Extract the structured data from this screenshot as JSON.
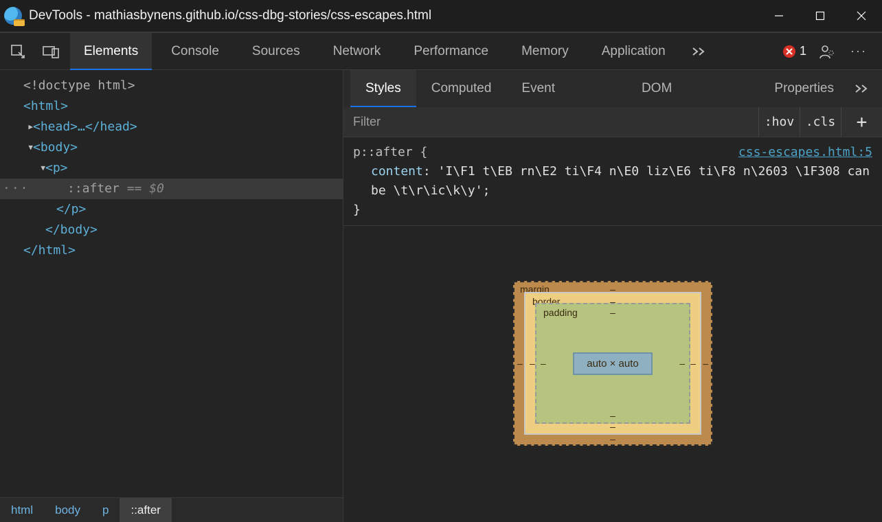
{
  "window": {
    "title": "DevTools - mathiasbynens.github.io/css-dbg-stories/css-escapes.html"
  },
  "mainTabs": {
    "elements": "Elements",
    "console": "Console",
    "sources": "Sources",
    "network": "Network",
    "performance": "Performance",
    "memory": "Memory",
    "application": "Application"
  },
  "errors": {
    "count": "1"
  },
  "domTree": {
    "doctype": "<!doctype html>",
    "htmlOpen": "<html>",
    "headCollapsed": "<head>…</head>",
    "bodyOpen": "<body>",
    "pOpen": "<p>",
    "pseudoAfter": "::after",
    "pseudoEq": " == ",
    "pseudoDollar": "$0",
    "pClose": "</p>",
    "bodyClose": "</body>",
    "htmlClose": "</html>"
  },
  "crumbs": {
    "c0": "html",
    "c1": "body",
    "c2": "p",
    "c3": "::after"
  },
  "subTabs": {
    "styles": "Styles",
    "computed": "Computed",
    "events": "Event Listeners",
    "dom": "DOM Breakpoints",
    "properties": "Properties"
  },
  "filter": {
    "placeholder": "Filter",
    "hov": ":hov",
    "cls": ".cls",
    "plus": "+"
  },
  "rule": {
    "selector": "p::after {",
    "link": "css-escapes.html:5",
    "prop": "content",
    "value": "'I\\F1 t\\EB rn\\E2 ti\\F4 n\\E0 liz\\E6 ti\\F8 n\\2603 \\1F308 can be \\t\\r\\ic\\k\\y'",
    "close": "}"
  },
  "boxModel": {
    "margin": "margin",
    "border": "border",
    "padding": "padding",
    "content": "auto × auto",
    "dash": "–"
  }
}
